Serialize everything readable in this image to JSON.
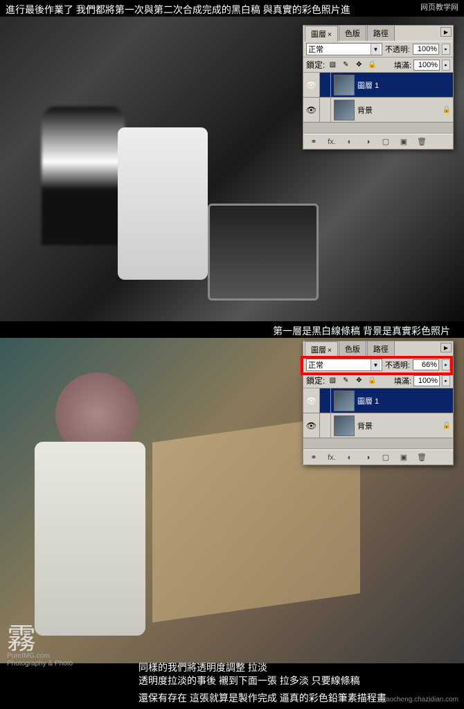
{
  "top_text": "進行最後作業了  我們都將第一次與第二次合成完成的黑白稿  與真實的彩色照片進",
  "watermark_tr": "网页教学网",
  "mid_text": "第一層是黑白線條稿  背景是真實彩色照片",
  "bottom_text_1": "同樣的我們將透明度調整  拉淡",
  "bottom_text_2": "透明度拉淡的事後  襯到下面一張  拉多淡  只要線條稿",
  "bottom_text_3": "還保有存在  這張就算是製作完成  逼真的彩色鉛筆素描程畫",
  "logo_text": "霧",
  "logo_sub": "PureIMG.com",
  "logo_sub2": "Photography & Photo",
  "watermark_br": "jiaocheng.chazidian.com",
  "panel": {
    "tabs": {
      "layers": "圖層",
      "channels": "色版",
      "paths": "路徑"
    },
    "blend_mode": "正常",
    "opacity_label": "不透明:",
    "fill_label": "填滿:",
    "lock_label": "鎖定:",
    "opacity_100": "100%",
    "opacity_66": "66%",
    "fill_100": "100%",
    "layers": {
      "layer1": "圖層 1",
      "background": "背景"
    }
  }
}
